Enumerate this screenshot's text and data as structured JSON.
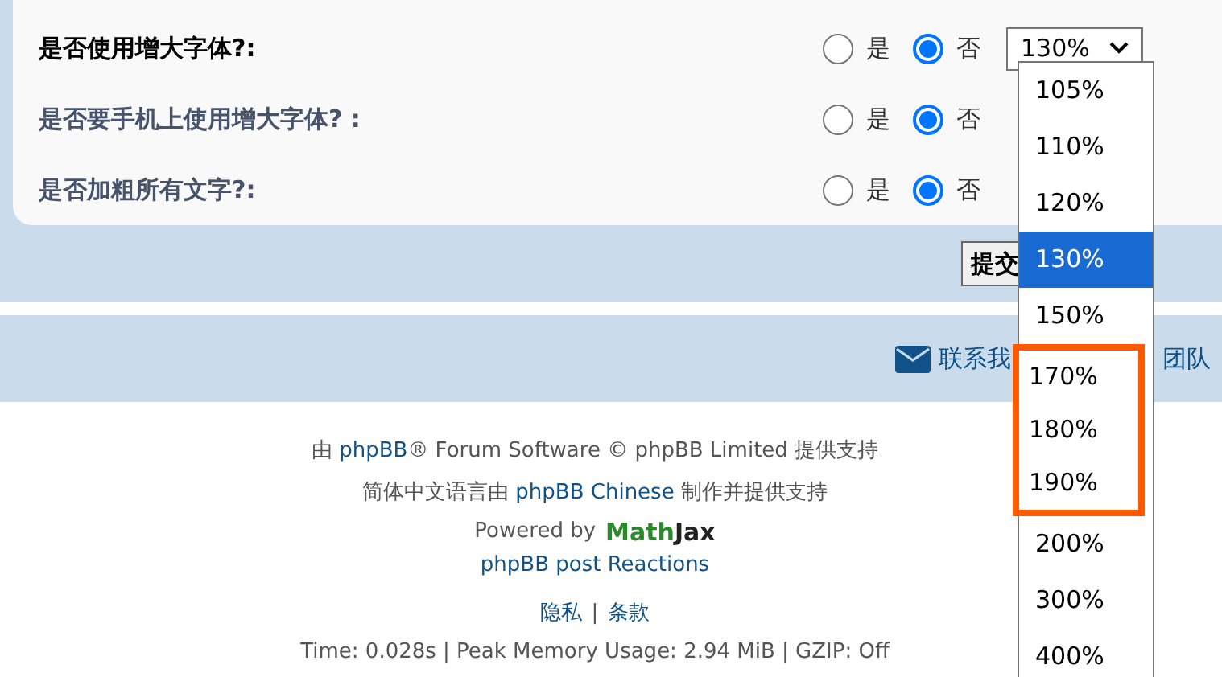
{
  "settings": [
    {
      "label": "是否使用增大字体?:",
      "emphasized": true,
      "options": [
        {
          "label": "是",
          "selected": false
        },
        {
          "label": "否",
          "selected": true
        }
      ],
      "select": {
        "value": "130%"
      }
    },
    {
      "label": "是否要手机上使用增大字体? :",
      "emphasized": false,
      "options": [
        {
          "label": "是",
          "selected": false
        },
        {
          "label": "否",
          "selected": true
        }
      ]
    },
    {
      "label": "是否加粗所有文字?:",
      "emphasized": false,
      "options": [
        {
          "label": "是",
          "selected": false
        },
        {
          "label": "否",
          "selected": true
        }
      ]
    }
  ],
  "submit_button": "提交",
  "dropdown": [
    {
      "label": "105%",
      "selected": false,
      "marked": false
    },
    {
      "label": "110%",
      "selected": false,
      "marked": false
    },
    {
      "label": "120%",
      "selected": false,
      "marked": false
    },
    {
      "label": "130%",
      "selected": true,
      "marked": false
    },
    {
      "label": "150%",
      "selected": false,
      "marked": false
    },
    {
      "label": "170%",
      "selected": false,
      "marked": true
    },
    {
      "label": "180%",
      "selected": false,
      "marked": true
    },
    {
      "label": "190%",
      "selected": false,
      "marked": true
    },
    {
      "label": "200%",
      "selected": false,
      "marked": false
    },
    {
      "label": "300%",
      "selected": false,
      "marked": false
    },
    {
      "label": "400%",
      "selected": false,
      "marked": false
    }
  ],
  "nav": {
    "contact_link": "联系我",
    "team_link": "团队"
  },
  "footer": {
    "line_1": [
      {
        "text": "由 ",
        "link": false
      },
      {
        "text": "phpBB",
        "link": true
      },
      {
        "text": "® Forum Software © phpBB Limited 提供支持",
        "link": false
      }
    ],
    "line_2": [
      {
        "text": "简体中文语言由 ",
        "link": false
      },
      {
        "text": "phpBB Chinese",
        "link": true
      },
      {
        "text": " 制作并提供支持",
        "link": false
      }
    ],
    "powered_by": "Powered by",
    "logo": [
      "Math",
      "Jax"
    ],
    "reactions_link": "phpBB post Reactions",
    "links": [
      "隐私",
      "条款"
    ],
    "separator": "|",
    "stats": "Time: 0.028s | Peak Memory Usage: 2.94 MiB | GZIP: Off"
  }
}
